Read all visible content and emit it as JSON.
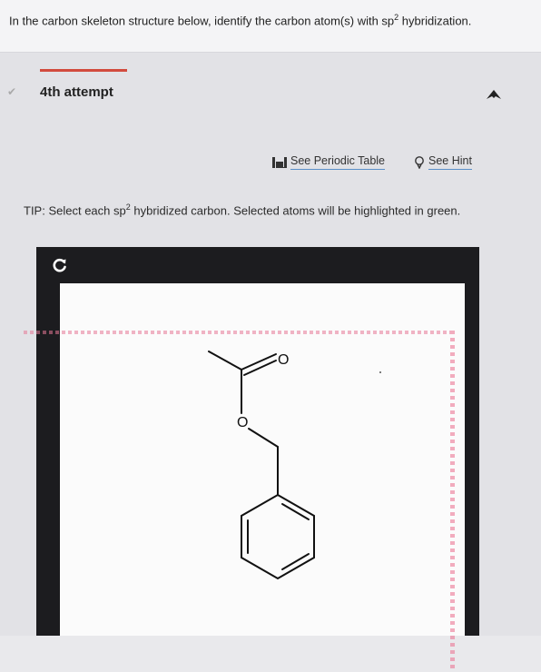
{
  "question": {
    "text_before": "In the carbon skeleton structure below, identify the carbon atom(s) with sp",
    "superscript": "2",
    "text_after": " hybridization."
  },
  "attempt": {
    "label": "4th attempt"
  },
  "tools": {
    "periodic_table": "See Periodic Table",
    "hint": "See Hint"
  },
  "tip": {
    "text_before": "TIP: Select each sp",
    "superscript": "2",
    "text_after": " hybridized carbon. Selected atoms will be highlighted in green."
  },
  "molecule": {
    "atom_labels": {
      "carbonyl_oxygen": "O",
      "ester_oxygen": "O"
    }
  },
  "colors": {
    "accent_red": "#d24b3e",
    "link_underline": "#5a8fc8",
    "editor_frame": "#1c1c1f"
  }
}
